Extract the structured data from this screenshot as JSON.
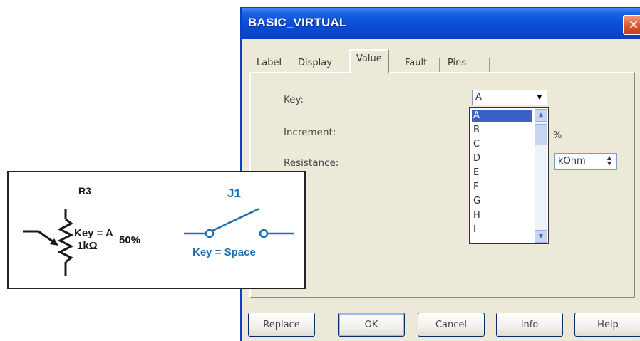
{
  "dialog": {
    "title": "BASIC_VIRTUAL",
    "close_glyph": "✕",
    "tabs": [
      {
        "label": "Label"
      },
      {
        "label": "Display"
      },
      {
        "label": "Value"
      },
      {
        "label": "Fault"
      },
      {
        "label": "Pins"
      }
    ],
    "active_tab": "Value",
    "fields": {
      "key_label": "Key:",
      "key_value": "A",
      "increment_label": "Increment:",
      "increment_unit": "%",
      "resistance_label": "Resistance:",
      "resistance_unit": "kOhm"
    },
    "dropdown_options": [
      "A",
      "B",
      "C",
      "D",
      "E",
      "F",
      "G",
      "H",
      "I"
    ],
    "dropdown_selected": "A",
    "buttons": {
      "replace": "Replace",
      "ok": "OK",
      "cancel": "Cancel",
      "info": "Info",
      "help": "Help"
    }
  },
  "schematic": {
    "r3": {
      "ref": "R3",
      "key_text": "Key = A",
      "percent": "50%",
      "value": "1kΩ"
    },
    "j1": {
      "ref": "J1",
      "key_text": "Key = Space"
    },
    "colors": {
      "resistor": "#1a1a1a",
      "switch": "#1d6fb0"
    }
  },
  "icons": [
    "close-icon",
    "dropdown-arrow-icon",
    "scroll-up-icon",
    "scroll-down-icon",
    "spin-icon"
  ]
}
